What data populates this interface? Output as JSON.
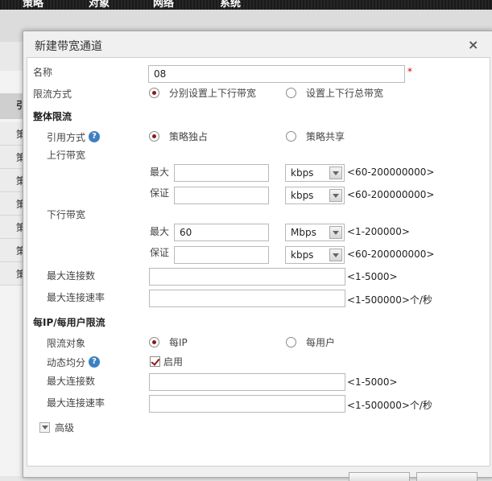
{
  "topnav": [
    "策略",
    "对象",
    "网络",
    "系统"
  ],
  "left_list": {
    "header": "引",
    "items": [
      "策",
      "策",
      "策",
      "策",
      "策",
      "策",
      "策"
    ]
  },
  "dialog": {
    "title": "新建带宽通道",
    "close": "×",
    "name_label": "名称",
    "name_value": "08",
    "required_mark": "*",
    "mode_label": "限流方式",
    "mode_options": [
      "分别设置上下行带宽",
      "设置上下行总带宽"
    ],
    "overall_section": "整体限流",
    "ref_label": "引用方式",
    "help_glyph": "?",
    "ref_options": [
      "策略独占",
      "策略共享"
    ],
    "up_label": "上行带宽",
    "down_label": "下行带宽",
    "max_label": "最大",
    "guarantee_label": "保证",
    "up_max": {
      "value": "",
      "unit": "kbps",
      "hint": "<60-200000000>"
    },
    "up_guarantee": {
      "value": "",
      "unit": "kbps",
      "hint": "<60-200000000>"
    },
    "down_max": {
      "value": "60",
      "unit": "Mbps",
      "hint": "<1-200000>"
    },
    "down_guarantee": {
      "value": "",
      "unit": "kbps",
      "hint": "<60-200000000>"
    },
    "max_conn_label": "最大连接数",
    "max_conn_hint": "<1-5000>",
    "max_rate_label": "最大连接速率",
    "max_rate_hint": "<1-500000>个/秒",
    "perip_section": "每IP/每用户限流",
    "target_label": "限流对象",
    "target_options": [
      "每IP",
      "每用户"
    ],
    "dyn_label": "动态均分",
    "dyn_enable": "启用",
    "ip_max_conn_label": "最大连接数",
    "ip_max_conn_hint": "<1-5000>",
    "ip_max_rate_label": "最大连接速率",
    "ip_max_rate_hint": "<1-500000>个/秒",
    "advanced": "高级"
  }
}
